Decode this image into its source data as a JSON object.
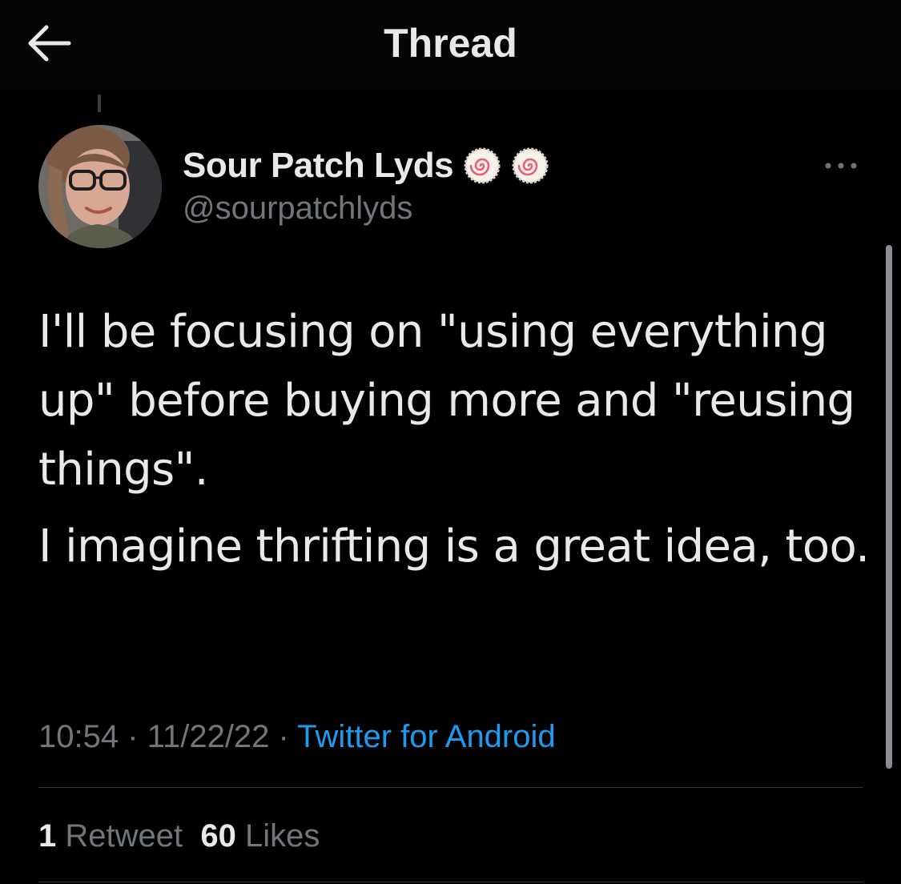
{
  "header": {
    "title": "Thread",
    "back_icon": "arrow-left-icon"
  },
  "tweet": {
    "author": {
      "display_name": "Sour Patch Lyds",
      "handle": "@sourpatchlyds",
      "avatar_icon": "profile-photo",
      "badge_icon": "narutomaki-swirl-icon"
    },
    "paragraphs": [
      "I'll be focusing on \"using everything up\" before buying more and \"reusing things\".",
      "I imagine thrifting is a great idea, too."
    ],
    "time": "10:54",
    "date": "11/22/22",
    "separator": "·",
    "source": "Twitter for Android",
    "retweets": {
      "count": "1",
      "label": "Retweet"
    },
    "likes": {
      "count": "60",
      "label": "Likes"
    }
  },
  "colors": {
    "background": "#000000",
    "text": "#e7e9ea",
    "muted": "#71767b",
    "link": "#1d9bf0",
    "divider": "#2f3336"
  }
}
